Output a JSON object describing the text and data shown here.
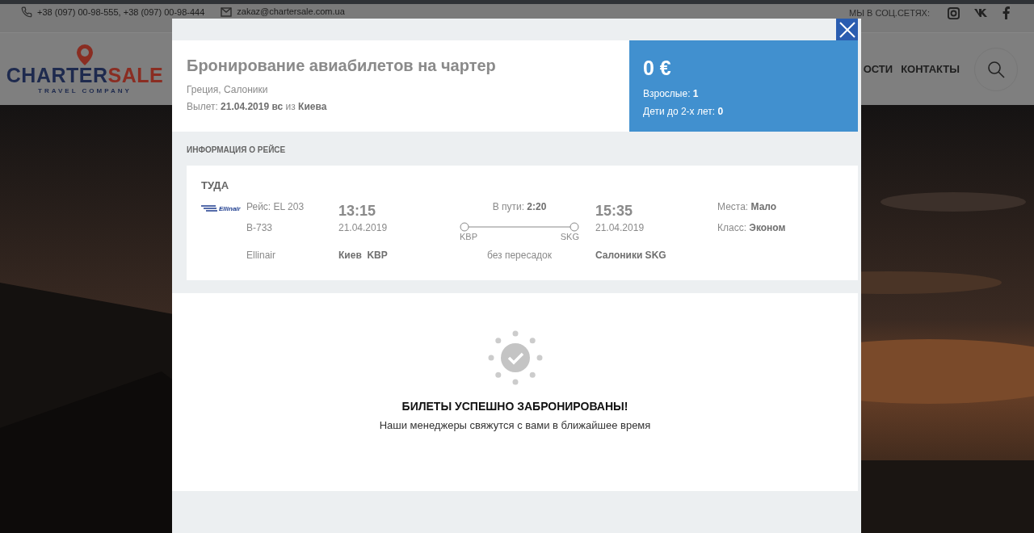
{
  "topbar": {
    "phones": "+38 (097) 00-98-555, +38 (097) 00-98-444",
    "email": "zakaz@chartersale.com.ua",
    "social_label": "МЫ В СОЦ.СЕТЯХ:"
  },
  "logo": {
    "brand_first": "CHARTER",
    "brand_second": "SALE",
    "tagline": "TRAVEL COMPANY"
  },
  "nav": [
    "ОСТИ",
    "КОНТАКТЫ"
  ],
  "modal": {
    "title": "Бронирование авиабилетов на чартер",
    "destination": "Греция, Салоники",
    "departure": "Вылет: **21.04.2019 вс** из **Киева**",
    "price": "0 €",
    "adults": "Взрослые: **1**",
    "children": "Дети до 2-х лет: **0**",
    "section_label": "ИНФОРМАЦИЯ О РЕЙСЕ",
    "flight": {
      "direction": "ТУДА",
      "airline_logo": "Ellinair",
      "flight_number": "Рейс: EL 203",
      "aircraft": "B-733",
      "airline": "Ellinair",
      "departure_time": "13:15",
      "departure_date": "21.04.2019",
      "departure_city": "Киев  KBP",
      "duration": "В пути: **2:20**",
      "from_code": "KBP",
      "to_code": "SKG",
      "stops": "без пересадок",
      "arrival_time": "15:35",
      "arrival_date": "21.04.2019",
      "arrival_city": "Салоники SKG",
      "seats": "Места: **Мало**",
      "class": "Класс: **Эконом**"
    },
    "success": {
      "title": "БИЛЕТЫ УСПЕШНО ЗАБРОНИРОВАНЫ!",
      "message": "Наши менеджеры свяжутся с вами в ближайшее время"
    }
  }
}
